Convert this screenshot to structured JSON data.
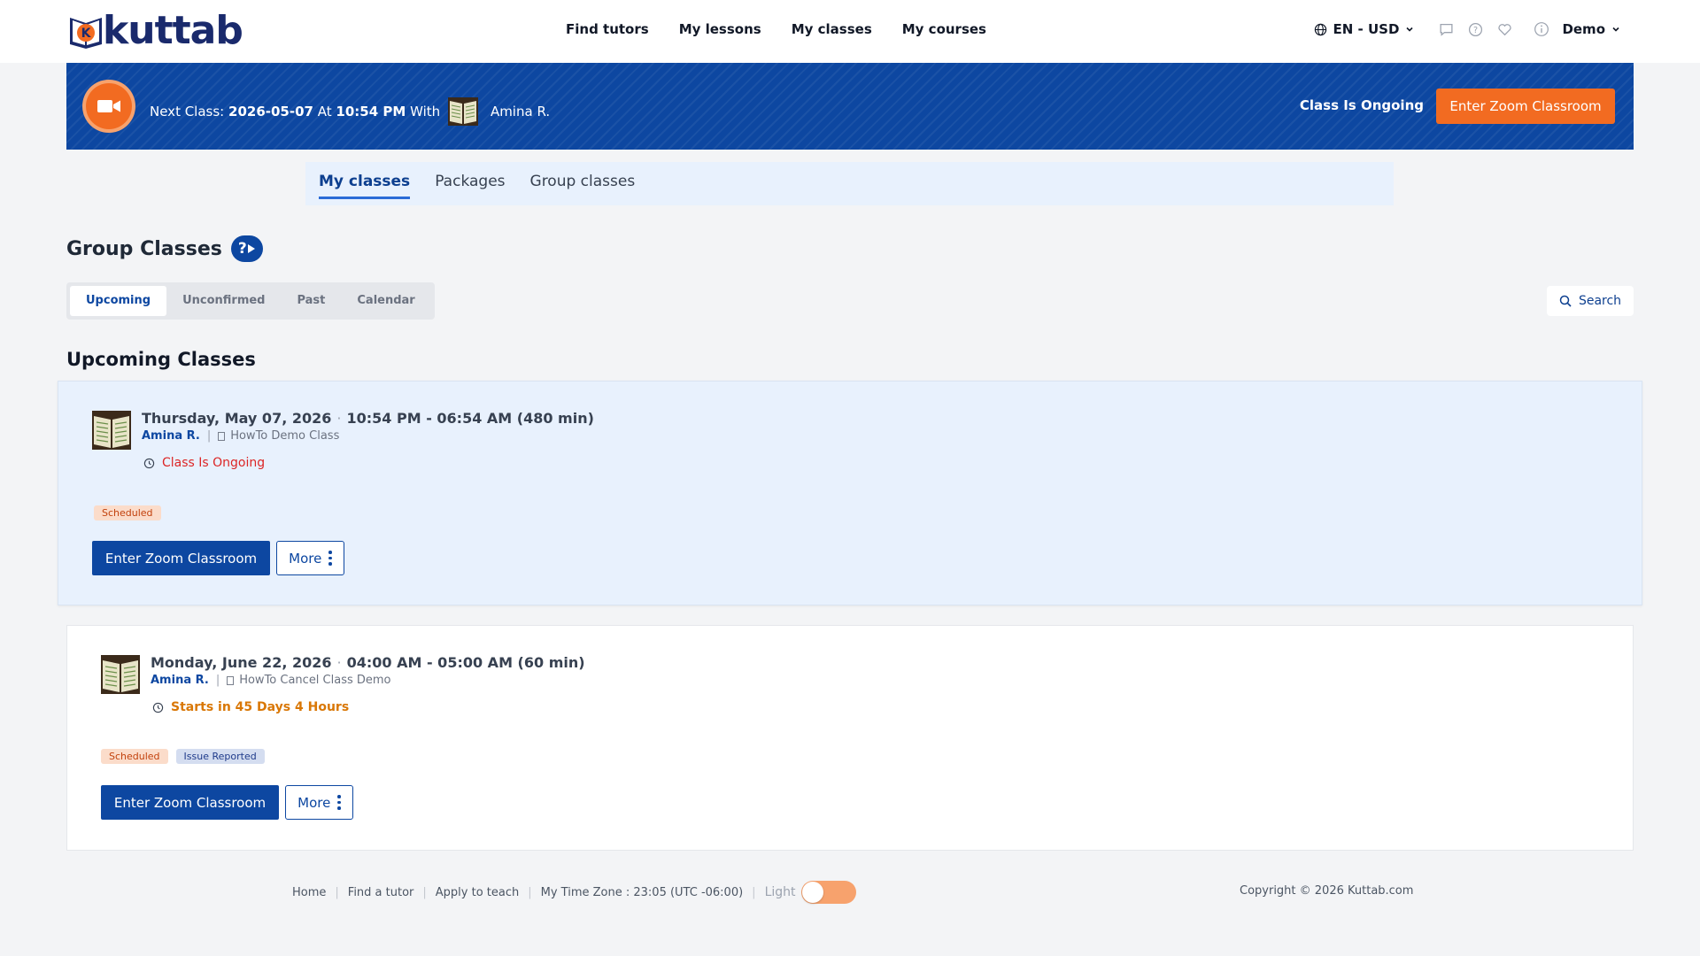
{
  "header": {
    "logo_text": "kuttab",
    "nav": [
      "Find tutors",
      "My lessons",
      "My classes",
      "My courses"
    ],
    "language": "EN - USD",
    "user": "Demo",
    "icons": [
      "globe-icon",
      "chat-icon",
      "help-icon",
      "heart-icon",
      "info-icon",
      "chevron-down-icon"
    ]
  },
  "banner": {
    "prefix": "Next Class:",
    "date": "2026-05-07",
    "at": "At",
    "time": "10:54 PM",
    "with": "With",
    "tutor": "Amina R.",
    "status": "Class Is Ongoing",
    "button": "Enter Zoom Classroom"
  },
  "tabs": [
    {
      "label": "My classes",
      "active": true
    },
    {
      "label": "Packages",
      "active": false
    },
    {
      "label": "Group classes",
      "active": false
    }
  ],
  "section_title": "Group Classes",
  "help_icon_label": "?",
  "segments": [
    {
      "label": "Upcoming",
      "active": true
    },
    {
      "label": "Unconfirmed",
      "active": false
    },
    {
      "label": "Past",
      "active": false
    },
    {
      "label": "Calendar",
      "active": false
    }
  ],
  "search_label": "Search",
  "upcoming_title": "Upcoming Classes",
  "classes": [
    {
      "date": "Thursday, May 07, 2026",
      "time": "10:54 PM - 06:54 AM (480 min)",
      "tutor": "Amina R.",
      "title": "HowTo Demo Class",
      "status": "Class Is Ongoing",
      "status_color": "#dc2626",
      "badges": [
        "Scheduled"
      ],
      "enter_label": "Enter Zoom Classroom",
      "more_label": "More"
    },
    {
      "date": "Monday, June 22, 2026",
      "time": "04:00 AM - 05:00 AM (60 min)",
      "tutor": "Amina R.",
      "title": "HowTo Cancel Class Demo",
      "status": "Starts in 45 Days 4 Hours",
      "status_color": "#d97706",
      "badges": [
        "Scheduled",
        "Issue Reported"
      ],
      "enter_label": "Enter Zoom Classroom",
      "more_label": "More"
    }
  ],
  "footer": {
    "links": [
      "Home",
      "Find a tutor",
      "Apply to teach"
    ],
    "timezone": "My Time Zone : 23:05 (UTC -06:00)",
    "theme_label": "Light",
    "copyright": "Copyright © 2026 Kuttab.com"
  },
  "colors": {
    "primary": "#0d47a1",
    "accent": "#f26b21",
    "tab_bg": "#e8f1fd"
  }
}
